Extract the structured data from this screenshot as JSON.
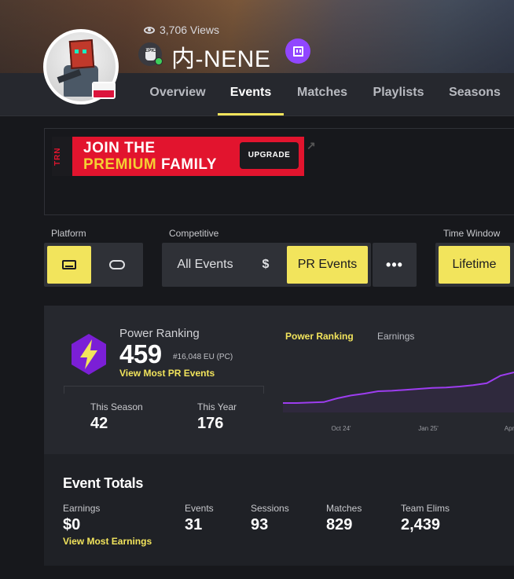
{
  "header": {
    "views": "3,706 Views",
    "player_name": "内-NENE",
    "platform_badge": "EPIC",
    "icons": [
      "eye-icon",
      "epic-games-icon",
      "verified-check-icon",
      "twitch-icon",
      "poland-flag-icon"
    ]
  },
  "tabs": [
    {
      "label": "Overview",
      "active": false
    },
    {
      "label": "Events",
      "active": true
    },
    {
      "label": "Matches",
      "active": false
    },
    {
      "label": "Playlists",
      "active": false
    },
    {
      "label": "Seasons",
      "active": false
    }
  ],
  "ad": {
    "brand": "TRN",
    "line1": "JOIN THE",
    "line2_highlight": "PREMIUM",
    "line2_rest": "FAMILY",
    "button": "UPGRADE"
  },
  "filters": {
    "platform_label": "Platform",
    "competitive_label": "Competitive",
    "time_window_label": "Time Window",
    "all_events": "All Events",
    "earnings_symbol": "$",
    "pr_events": "PR Events",
    "more": "•••",
    "lifetime": "Lifetime"
  },
  "power_ranking": {
    "title": "Power Ranking",
    "value": "459",
    "rank": "#16,048 EU (PC)",
    "link": "View Most PR Events",
    "this_season_label": "This Season",
    "this_season_value": "42",
    "this_year_label": "This Year",
    "this_year_value": "176"
  },
  "chart_tabs": {
    "active": "Power Ranking",
    "inactive": "Earnings"
  },
  "chart_data": {
    "type": "line",
    "series": [
      {
        "values": [
          20,
          20,
          21,
          22,
          30,
          36,
          40,
          45,
          46,
          48,
          50,
          52,
          53,
          55,
          58,
          62,
          78,
          85
        ]
      }
    ],
    "x_tick_labels": [
      "Oct 24'",
      "Jan 25'",
      "Apr"
    ],
    "color": "#9d3df0"
  },
  "event_totals": {
    "title": "Event Totals",
    "earnings_label": "Earnings",
    "earnings_value": "$0",
    "earnings_link": "View Most Earnings",
    "events_label": "Events",
    "events_value": "31",
    "sessions_label": "Sessions",
    "sessions_value": "93",
    "matches_label": "Matches",
    "matches_value": "829",
    "team_elims_label": "Team Elims",
    "team_elims_value": "2,439"
  },
  "colors": {
    "accent": "#f2e45c",
    "background": "#17181c",
    "card": "#26282e",
    "pr_icon": "#7b1fd6",
    "line": "#9d3df0"
  }
}
